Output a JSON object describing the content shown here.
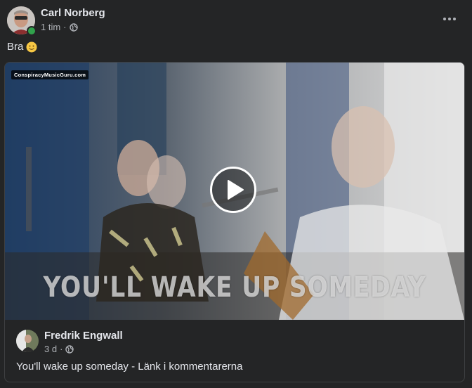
{
  "post": {
    "author": "Carl Norberg",
    "time": "1 tim",
    "separator": "·",
    "text": "Bra",
    "emoji_icon": "slightly-smiling-face-icon",
    "privacy_icon": "globe-icon"
  },
  "shared": {
    "watermark": "ConspiracyMusicGuru.com",
    "video_caption": "YOU'LL WAKE UP SOMEDAY",
    "author": "Fredrik Engwall",
    "time": "3 d",
    "separator": "·",
    "text": "You'll wake up someday - Länk i kommentarerna",
    "privacy_icon": "globe-icon"
  },
  "colors": {
    "background": "#242526",
    "primary_text": "#e4e6eb",
    "secondary_text": "#b0b3b8",
    "online": "#31a24c",
    "border": "#3e4042"
  }
}
